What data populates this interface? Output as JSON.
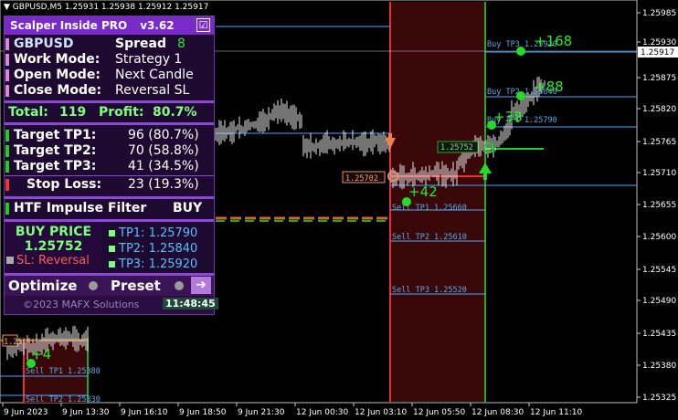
{
  "header": {
    "symbol_tf": "GBPUSD,M5",
    "quotes": "1.25931 1.25938 1.25912 1.25917"
  },
  "panel": {
    "title": "Scalper Inside PRO",
    "version": "v3.62",
    "checkbox": "☑",
    "symbol": "GBPUSD",
    "spread_label": "Spread",
    "spread_value": "8",
    "work_mode_label": "Work Mode:",
    "work_mode_value": "Strategy 1",
    "open_mode_label": "Open Mode:",
    "open_mode_value": "Next Candle",
    "close_mode_label": "Close Mode:",
    "close_mode_value": "Reversal SL",
    "total_label": "Total:",
    "total_value": "119",
    "profit_label": "Profit:",
    "profit_value": "80.7%",
    "tp1_label": "Target TP1:",
    "tp1_value": "96 (80.7%)",
    "tp2_label": "Target TP2:",
    "tp2_value": "70 (58.8%)",
    "tp3_label": "Target TP3:",
    "tp3_value": "41 (34.5%)",
    "sl_label": "Stop Loss:",
    "sl_value": "23 (19.3%)",
    "htf_label": "HTF Impulse Filter",
    "htf_value": "BUY",
    "signal_label": "BUY PRICE",
    "signal_price": "1.25752",
    "sl_mode": "SL: Reversal",
    "sig_tp1": "TP1: 1.25790",
    "sig_tp2": "TP2: 1.25840",
    "sig_tp3": "TP3: 1.25920",
    "optimize_label": "Optimize",
    "preset_label": "Preset",
    "copyright": "©2023 MAFX Solutions",
    "clock": "11:48:45"
  },
  "price_axis": {
    "ticks": [
      "1.25985",
      "1.25930",
      "1.25917",
      "1.25875",
      "1.25820",
      "1.25765",
      "1.25710",
      "1.25655",
      "1.25600",
      "1.25545",
      "1.25490",
      "1.25435",
      "1.25380",
      "1.25325"
    ],
    "current_price": "1.25917"
  },
  "time_axis": {
    "ticks": [
      "9 Jun 2023",
      "9 Jun 13:30",
      "9 Jun 16:10",
      "9 Jun 18:50",
      "9 Jun 21:30",
      "12 Jun 00:30",
      "12 Jun 03:10",
      "12 Jun 05:50",
      "12 Jun 08:30",
      "12 Jun 11:10"
    ]
  },
  "chart_labels": {
    "buy_tp3": "Buy TP3 1.25920",
    "buy_tp2": "Buy TP2 1.25840",
    "buy_tp1": "Buy TP1 1.25790",
    "buy_entry": "1.25752",
    "sell_entry": "1.25702",
    "sell_tp1": "Sell TP1 1.25660",
    "sell_tp2": "Sell TP2 1.25610",
    "sell_tp3": "Sell TP3 1.25520",
    "old_sell_tp1": "Sell TP1 1.25380",
    "old_sell_tp2": "Sell TP2 1.25330",
    "pips_168": "+168",
    "pips_88a": "+88",
    "pips_38": "+38",
    "pips_42": "+42",
    "pips_4": "+4",
    "old_level": "1.25"
  },
  "colors": {
    "sell_zone": "#3a0808",
    "buy_zone": "#0b2a0b",
    "sell_line": "#e33030",
    "buy_line": "#22aa22",
    "level_line": "#4aa8ff"
  }
}
